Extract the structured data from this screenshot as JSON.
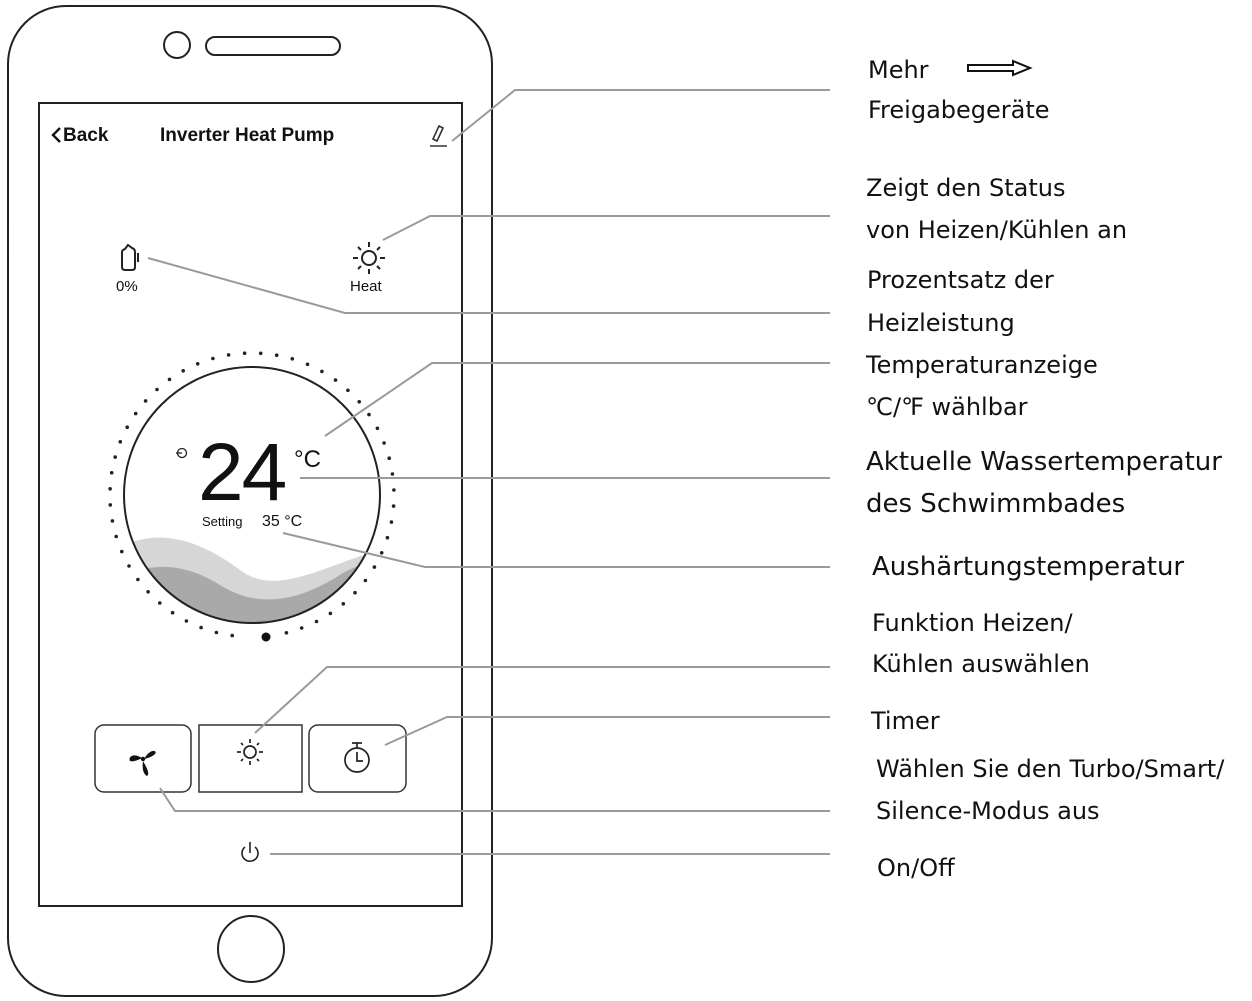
{
  "app": {
    "back_label": "Back",
    "title": "Inverter Heat Pump",
    "percent_value": "0%",
    "mode_label": "Heat",
    "current_temp": "24",
    "current_temp_unit": "°C",
    "setting_label": "Setting",
    "setting_value": "35 °C",
    "icons": {
      "back": "chevron-left-icon",
      "edit": "pencil-icon",
      "percent": "heating-capacity-icon",
      "mode": "sun-icon",
      "setpoint": "arrow-in-icon",
      "fan": "fan-icon",
      "mode_button": "sun-icon",
      "timer": "stopwatch-icon",
      "power": "power-icon"
    }
  },
  "callouts": {
    "share_line1": "Mehr",
    "share_line2": "Freigabegeräte",
    "status_line1": "Zeigt den Status",
    "status_line2": "von Heizen/Kühlen an",
    "percent_line1": "Prozentsatz der",
    "percent_line2": "Heizleistung",
    "unit_line1": "Temperaturanzeige",
    "unit_line2": "℃/℉  wählbar",
    "water_line1": "Aktuelle Wassertemperatur",
    "water_line2": "des Schwimmbades",
    "setpoint": "Aushärtungstemperatur",
    "mode_line1": "Funktion Heizen/",
    "mode_line2": "Kühlen auswählen",
    "timer": "Timer",
    "fan_line1": "Wählen Sie den Turbo/Smart/",
    "fan_line2": "Silence-Modus aus",
    "power": "On/Off"
  }
}
